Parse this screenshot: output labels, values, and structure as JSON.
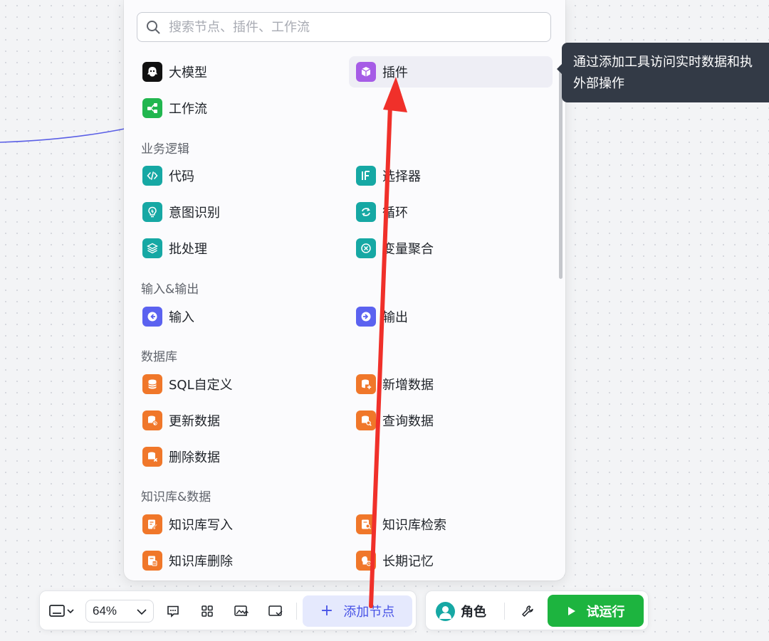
{
  "search": {
    "placeholder": "搜索节点、插件、工作流"
  },
  "top_items": {
    "llm": "大模型",
    "plugin": "插件",
    "workflow": "工作流"
  },
  "sections": {
    "logic": {
      "title": "业务逻辑",
      "items": [
        "代码",
        "选择器",
        "意图识别",
        "循环",
        "批处理",
        "变量聚合"
      ]
    },
    "io": {
      "title": "输入&输出",
      "items": [
        "输入",
        "输出"
      ]
    },
    "database": {
      "title": "数据库",
      "items": [
        "SQL自定义",
        "新增数据",
        "更新数据",
        "查询数据",
        "删除数据"
      ]
    },
    "knowledge": {
      "title": "知识库&数据",
      "items": [
        "知识库写入",
        "知识库检索",
        "知识库删除",
        "长期记忆"
      ]
    }
  },
  "tooltip": {
    "line1": "通过添加工具访问实时数据和执",
    "line2": "外部操作"
  },
  "toolbar": {
    "zoom": "64%",
    "add_node": "添加节点",
    "role": "角色",
    "run": "试运行"
  },
  "colors": {
    "teal": "#16a8a4",
    "orange": "#f0772a",
    "indigo": "#5b62f0",
    "green": "#21b64f",
    "purple": "#a65ce6",
    "run_button": "#1db43f",
    "add_node_text": "#4752e6",
    "arrow": "#f0302a",
    "tooltip_bg": "#333a46"
  }
}
